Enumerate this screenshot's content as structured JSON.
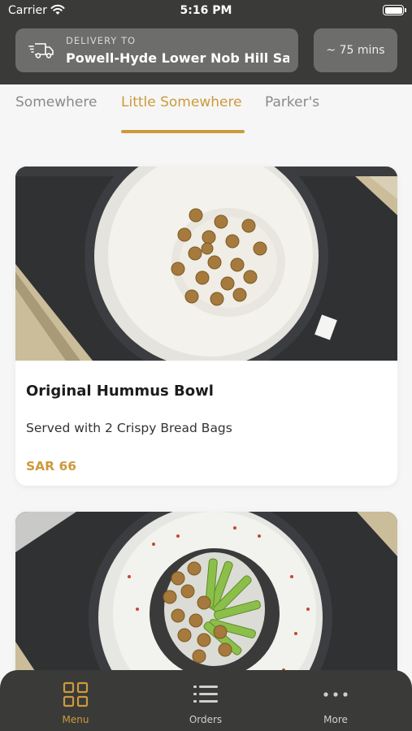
{
  "status_bar": {
    "carrier": "Carrier",
    "time": "5:16 PM"
  },
  "delivery": {
    "label": "DELIVERY TO",
    "address": "Powell-Hyde Lower Nob Hill Sa...",
    "eta": "~ 75 mins"
  },
  "tabs": [
    {
      "label": "Somewhere",
      "active": false
    },
    {
      "label": "Little Somewhere",
      "active": true
    },
    {
      "label": "Parker's",
      "active": false
    }
  ],
  "menu_items": [
    {
      "title": "Original Hummus Bowl",
      "description": "Served with 2 Crispy Bread Bags",
      "price": "SAR 66",
      "image": "hummus-bowl-chickpeas"
    },
    {
      "image": "hummus-bowl-cucumber-chickpeas"
    }
  ],
  "bottom_nav": [
    {
      "label": "Menu",
      "icon": "grid-icon",
      "active": true
    },
    {
      "label": "Orders",
      "icon": "list-icon",
      "active": false
    },
    {
      "label": "More",
      "icon": "more-dots-icon",
      "active": false
    }
  ],
  "colors": {
    "accent": "#cc9a3c",
    "header_bg": "#3a3a38",
    "pill_bg": "#6d6d6b",
    "page_bg": "#f6f6f6"
  }
}
